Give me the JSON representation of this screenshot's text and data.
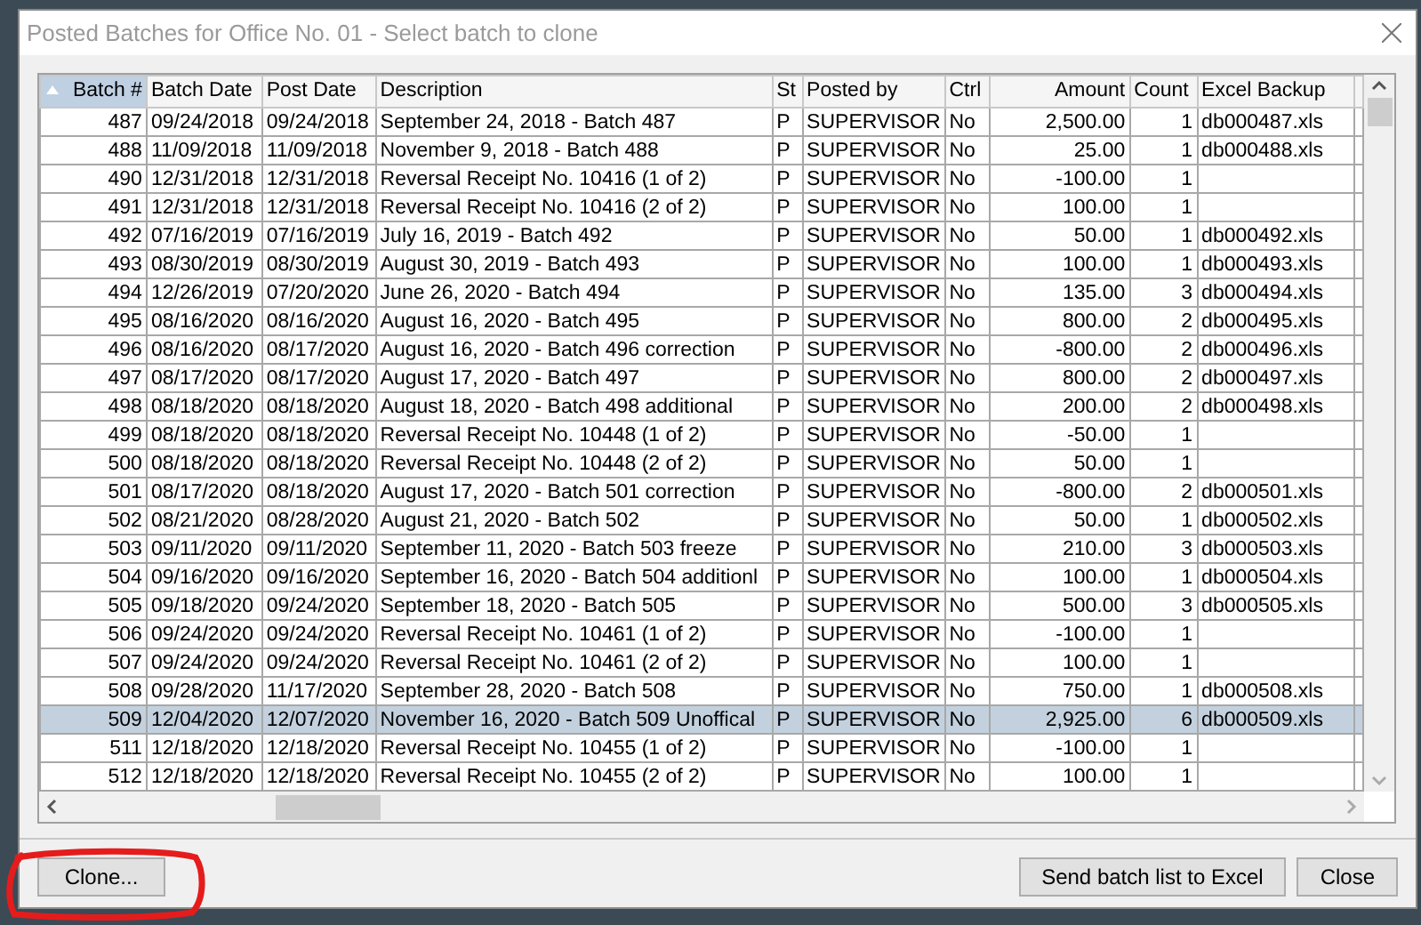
{
  "window": {
    "title": "Posted Batches for Office No. 01 - Select batch to clone"
  },
  "table": {
    "columns": [
      {
        "label": "Batch #",
        "sorted": true
      },
      {
        "label": "Batch Date",
        "sorted": false
      },
      {
        "label": "Post Date",
        "sorted": false
      },
      {
        "label": "Description",
        "sorted": false
      },
      {
        "label": "St",
        "sorted": false
      },
      {
        "label": "Posted by",
        "sorted": false
      },
      {
        "label": "Ctrl",
        "sorted": false
      },
      {
        "label": "Amount",
        "sorted": false
      },
      {
        "label": "Count",
        "sorted": false
      },
      {
        "label": "Excel Backup",
        "sorted": false
      }
    ],
    "rows": [
      {
        "cells": [
          "487",
          "09/24/2018",
          "09/24/2018",
          "September 24, 2018 - Batch 487",
          "P",
          "SUPERVISOR",
          "No",
          "2,500.00",
          "1",
          "db000487.xls"
        ],
        "selected": false
      },
      {
        "cells": [
          "488",
          "11/09/2018",
          "11/09/2018",
          "November 9, 2018 - Batch 488",
          "P",
          "SUPERVISOR",
          "No",
          "25.00",
          "1",
          "db000488.xls"
        ],
        "selected": false
      },
      {
        "cells": [
          "490",
          "12/31/2018",
          "12/31/2018",
          "Reversal Receipt No. 10416 (1 of 2)",
          "P",
          "SUPERVISOR",
          "No",
          "-100.00",
          "1"
        ],
        "selected": false
      },
      {
        "cells": [
          "491",
          "12/31/2018",
          "12/31/2018",
          "Reversal Receipt No. 10416 (2 of 2)",
          "P",
          "SUPERVISOR",
          "No",
          "100.00",
          "1"
        ],
        "selected": false
      },
      {
        "cells": [
          "492",
          "07/16/2019",
          "07/16/2019",
          "July 16, 2019 - Batch 492",
          "P",
          "SUPERVISOR",
          "No",
          "50.00",
          "1",
          "db000492.xls"
        ],
        "selected": false
      },
      {
        "cells": [
          "493",
          "08/30/2019",
          "08/30/2019",
          "August 30, 2019 - Batch 493",
          "P",
          "SUPERVISOR",
          "No",
          "100.00",
          "1",
          "db000493.xls"
        ],
        "selected": false
      },
      {
        "cells": [
          "494",
          "12/26/2019",
          "07/20/2020",
          "June 26, 2020 - Batch 494",
          "P",
          "SUPERVISOR",
          "No",
          "135.00",
          "3",
          "db000494.xls"
        ],
        "selected": false
      },
      {
        "cells": [
          "495",
          "08/16/2020",
          "08/16/2020",
          "August 16, 2020 - Batch 495",
          "P",
          "SUPERVISOR",
          "No",
          "800.00",
          "2",
          "db000495.xls"
        ],
        "selected": false
      },
      {
        "cells": [
          "496",
          "08/16/2020",
          "08/17/2020",
          "August 16, 2020 - Batch 496 correction",
          "P",
          "SUPERVISOR",
          "No",
          "-800.00",
          "2",
          "db000496.xls"
        ],
        "selected": false
      },
      {
        "cells": [
          "497",
          "08/17/2020",
          "08/17/2020",
          "August 17, 2020 - Batch 497",
          "P",
          "SUPERVISOR",
          "No",
          "800.00",
          "2",
          "db000497.xls"
        ],
        "selected": false
      },
      {
        "cells": [
          "498",
          "08/18/2020",
          "08/18/2020",
          "August 18, 2020 - Batch 498 additional",
          "P",
          "SUPERVISOR",
          "No",
          "200.00",
          "2",
          "db000498.xls"
        ],
        "selected": false
      },
      {
        "cells": [
          "499",
          "08/18/2020",
          "08/18/2020",
          "Reversal Receipt No. 10448 (1 of 2)",
          "P",
          "SUPERVISOR",
          "No",
          "-50.00",
          "1"
        ],
        "selected": false
      },
      {
        "cells": [
          "500",
          "08/18/2020",
          "08/18/2020",
          "Reversal Receipt No. 10448 (2 of 2)",
          "P",
          "SUPERVISOR",
          "No",
          "50.00",
          "1"
        ],
        "selected": false
      },
      {
        "cells": [
          "501",
          "08/17/2020",
          "08/18/2020",
          "August 17, 2020 - Batch 501 correction",
          "P",
          "SUPERVISOR",
          "No",
          "-800.00",
          "2",
          "db000501.xls"
        ],
        "selected": false
      },
      {
        "cells": [
          "502",
          "08/21/2020",
          "08/28/2020",
          "August 21, 2020 - Batch 502",
          "P",
          "SUPERVISOR",
          "No",
          "50.00",
          "1",
          "db000502.xls"
        ],
        "selected": false
      },
      {
        "cells": [
          "503",
          "09/11/2020",
          "09/11/2020",
          "September 11, 2020 - Batch 503  freeze",
          "P",
          "SUPERVISOR",
          "No",
          "210.00",
          "3",
          "db000503.xls"
        ],
        "selected": false
      },
      {
        "cells": [
          "504",
          "09/16/2020",
          "09/16/2020",
          "September 16, 2020 - Batch 504 additionl",
          "P",
          "SUPERVISOR",
          "No",
          "100.00",
          "1",
          "db000504.xls"
        ],
        "selected": false
      },
      {
        "cells": [
          "505",
          "09/18/2020",
          "09/24/2020",
          "September 18, 2020 - Batch 505",
          "P",
          "SUPERVISOR",
          "No",
          "500.00",
          "3",
          "db000505.xls"
        ],
        "selected": false
      },
      {
        "cells": [
          "506",
          "09/24/2020",
          "09/24/2020",
          "Reversal Receipt No. 10461 (1 of 2)",
          "P",
          "SUPERVISOR",
          "No",
          "-100.00",
          "1"
        ],
        "selected": false
      },
      {
        "cells": [
          "507",
          "09/24/2020",
          "09/24/2020",
          "Reversal Receipt No. 10461 (2 of 2)",
          "P",
          "SUPERVISOR",
          "No",
          "100.00",
          "1"
        ],
        "selected": false
      },
      {
        "cells": [
          "508",
          "09/28/2020",
          "11/17/2020",
          "September 28, 2020 - Batch 508",
          "P",
          "SUPERVISOR",
          "No",
          "750.00",
          "1",
          "db000508.xls"
        ],
        "selected": false
      },
      {
        "cells": [
          "509",
          "12/04/2020",
          "12/07/2020",
          "November 16, 2020 - Batch 509 Unoffical",
          "P",
          "SUPERVISOR",
          "No",
          "2,925.00",
          "6",
          "db000509.xls"
        ],
        "selected": true
      },
      {
        "cells": [
          "511",
          "12/18/2020",
          "12/18/2020",
          "Reversal Receipt No. 10455 (1 of 2)",
          "P",
          "SUPERVISOR",
          "No",
          "-100.00",
          "1"
        ],
        "selected": false
      },
      {
        "cells": [
          "512",
          "12/18/2020",
          "12/18/2020",
          "Reversal Receipt No. 10455 (2 of 2)",
          "P",
          "SUPERVISOR",
          "No",
          "100.00",
          "1"
        ],
        "selected": false
      }
    ]
  },
  "buttons": [
    {
      "label": "Clone...",
      "kind": "left"
    },
    {
      "label": "Send batch list to Excel",
      "kind": "right"
    },
    {
      "label": "Close",
      "kind": "right"
    }
  ]
}
